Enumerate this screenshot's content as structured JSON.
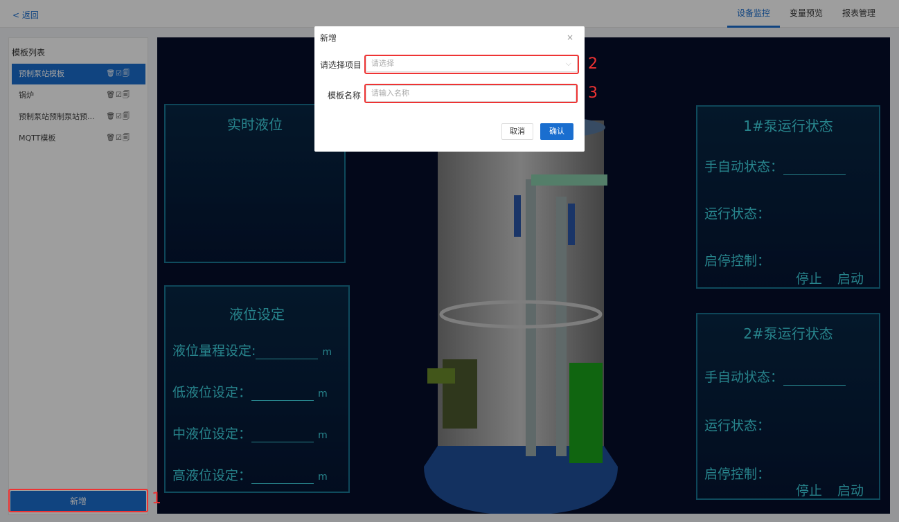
{
  "topbar": {
    "back_label": "< 返回",
    "tabs": [
      "设备监控",
      "变量预览",
      "报表管理"
    ]
  },
  "sidebar": {
    "title": "模板列表",
    "items": [
      {
        "label": "预制泵站模板",
        "ops": "🗑☑🗐"
      },
      {
        "label": "锅炉",
        "ops": "🗑☑🗐"
      },
      {
        "label": "预制泵站预制泵站预...",
        "ops": "🗑☑🗐"
      },
      {
        "label": "MQTT模板",
        "ops": "🗑☑🗐"
      }
    ],
    "add_label": "新增"
  },
  "scada": {
    "realtime_panel": {
      "title": "实时液位"
    },
    "level_panel": {
      "title": "液位设定",
      "rows": [
        {
          "label": "液位量程设定:",
          "unit": "m"
        },
        {
          "label": "低液位设定：",
          "unit": "m"
        },
        {
          "label": "中液位设定：",
          "unit": "m"
        },
        {
          "label": "高液位设定：",
          "unit": "m"
        }
      ]
    },
    "pump1": {
      "title": "1#泵运行状态",
      "auto": "手自动状态：",
      "run": "运行状态：",
      "ctrl": "启停控制：",
      "stop": "停止",
      "start": "启动"
    },
    "pump2": {
      "title": "2#泵运行状态",
      "auto": "手自动状态：",
      "run": "运行状态：",
      "ctrl": "启停控制：",
      "stop": "停止",
      "start": "启动"
    }
  },
  "dialog": {
    "title": "新增",
    "close": "×",
    "project_label": "请选择项目",
    "project_placeholder": "请选择",
    "name_label": "模板名称",
    "name_placeholder": "请输入名称",
    "cancel_label": "取消",
    "ok_label": "确认"
  },
  "annotations": [
    "1",
    "2",
    "3"
  ],
  "colors": {
    "accent": "#1a6ecf",
    "highlight": "#e33333",
    "hud_cyan": "#3fd3e0"
  }
}
